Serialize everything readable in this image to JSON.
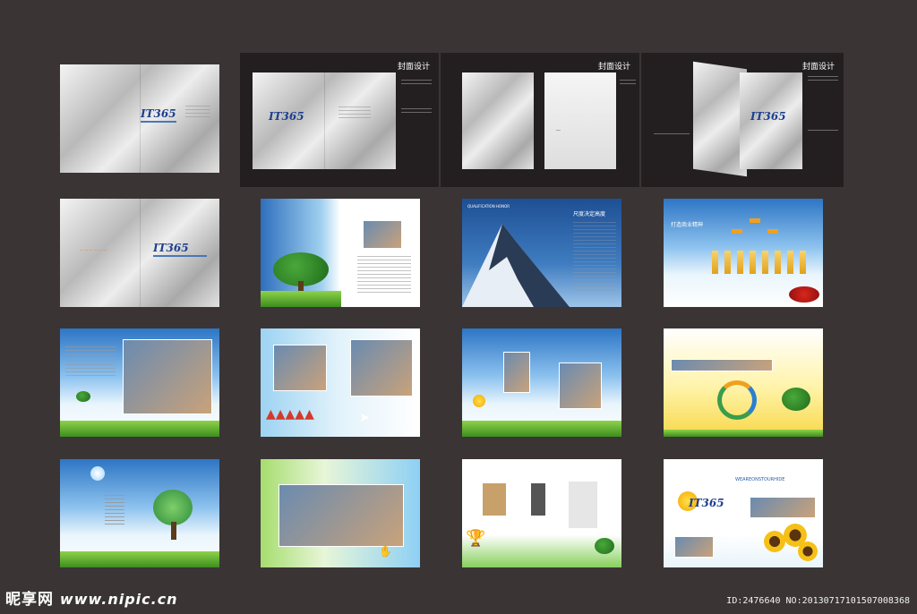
{
  "header": {
    "cover_title_1": "封面设计",
    "cover_title_2": "封面设计",
    "cover_title_3": "封面设计"
  },
  "cards": {
    "logo_text": "IT365",
    "mountain_caption": "QUALIFICATION HONOR",
    "mountain_title": "尺度决定高度",
    "org_title": "打造商业精神",
    "footer_title": "WEAREONSTOURHIDE"
  },
  "watermark": {
    "site_name": "昵享网",
    "site_url": "www.nipic.cn",
    "id_text": "ID:2476640 NO:20130717101507008368"
  },
  "colors": {
    "background": "#3a3435",
    "dark_panel": "#231f20",
    "brand_blue": "#1c3f8e"
  },
  "icons": [
    "tree-icon",
    "mountain-icon",
    "sun-icon",
    "sunflower-icon",
    "paper-plane-icon",
    "trophy-icon"
  ]
}
